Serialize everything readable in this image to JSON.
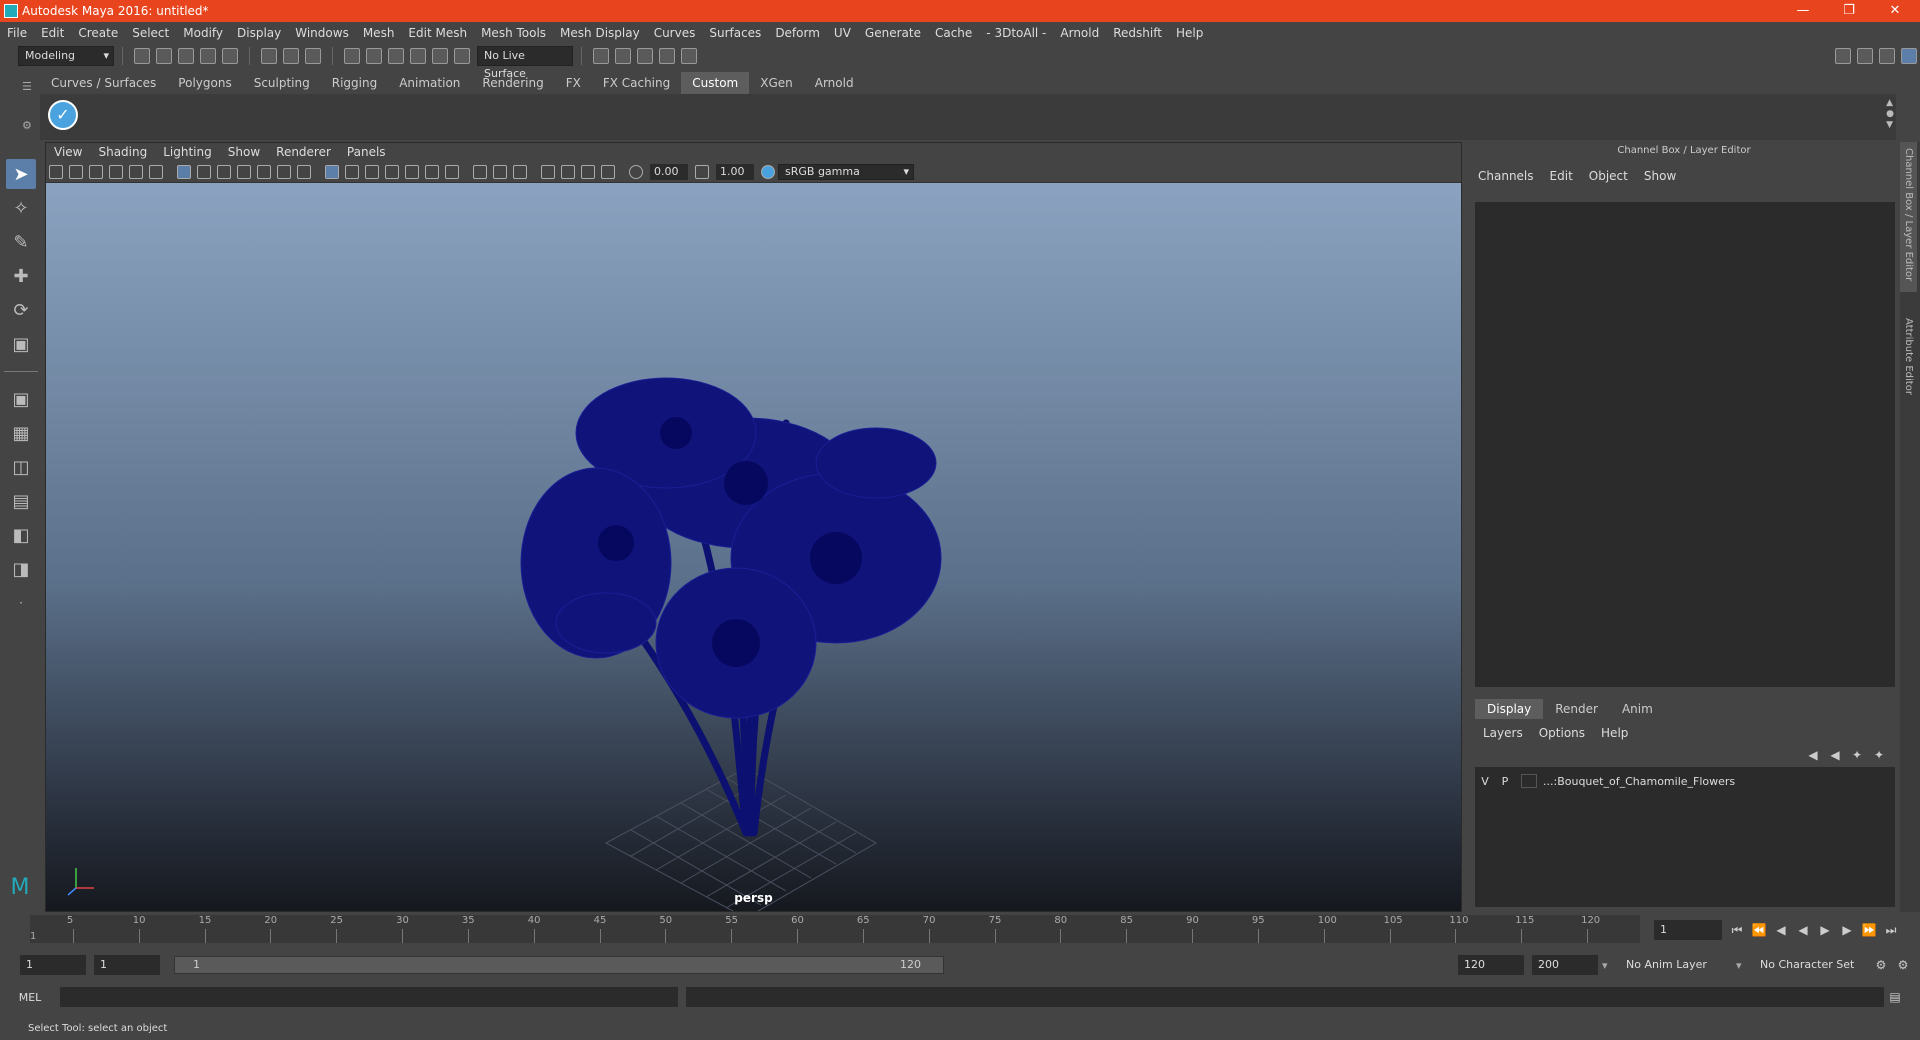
{
  "window": {
    "title": "Autodesk Maya 2016: untitled*"
  },
  "menubar": [
    "File",
    "Edit",
    "Create",
    "Select",
    "Modify",
    "Display",
    "Windows",
    "Mesh",
    "Edit Mesh",
    "Mesh Tools",
    "Mesh Display",
    "Curves",
    "Surfaces",
    "Deform",
    "UV",
    "Generate",
    "Cache",
    "- 3DtoAll -",
    "Arnold",
    "Redshift",
    "Help"
  ],
  "toolbar": {
    "mode": "Modeling",
    "live_surface": "No Live Surface"
  },
  "shelf_tabs": [
    "Curves / Surfaces",
    "Polygons",
    "Sculpting",
    "Rigging",
    "Animation",
    "Rendering",
    "FX",
    "FX Caching",
    "Custom",
    "XGen",
    "Arnold"
  ],
  "viewport": {
    "menus": [
      "View",
      "Shading",
      "Lighting",
      "Show",
      "Renderer",
      "Panels"
    ],
    "exposure": "0.00",
    "gamma": "1.00",
    "color_space": "sRGB gamma",
    "camera": "persp"
  },
  "channel_box": {
    "header": "Channel Box / Layer Editor",
    "menus": [
      "Channels",
      "Edit",
      "Object",
      "Show"
    ]
  },
  "layer_editor": {
    "tabs": [
      "Display",
      "Render",
      "Anim"
    ],
    "menus": [
      "Layers",
      "Options",
      "Help"
    ],
    "layer": {
      "v": "V",
      "p": "P",
      "name": "...:Bouquet_of_Chamomile_Flowers"
    }
  },
  "side_tabs": [
    "Channel Box / Layer Editor",
    "Attribute Editor"
  ],
  "timeline": {
    "ticks": [
      "5",
      "10",
      "15",
      "20",
      "25",
      "30",
      "35",
      "40",
      "45",
      "50",
      "55",
      "60",
      "65",
      "70",
      "75",
      "80",
      "85",
      "90",
      "95",
      "100",
      "105",
      "110",
      "115",
      "120"
    ],
    "start_marker": "1",
    "current_frame": "1"
  },
  "range": {
    "start": "1",
    "start2": "1",
    "slider_start": "1",
    "slider_end": "120",
    "end": "120",
    "end2": "200",
    "anim_layer": "No Anim Layer",
    "char_set": "No Character Set"
  },
  "cmdline": {
    "label": "MEL"
  },
  "status": "Select Tool: select an object"
}
